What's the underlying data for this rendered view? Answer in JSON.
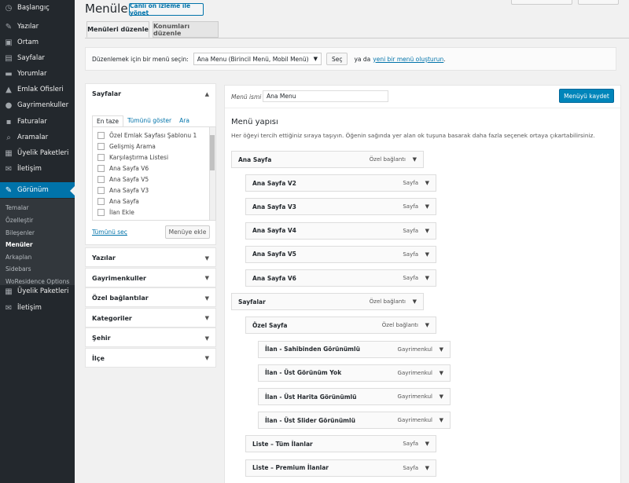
{
  "sidebar": {
    "items": [
      {
        "label": "Başlangıç",
        "icon": "dashboard-icon",
        "glyph": "◷"
      },
      {
        "label": "Yazılar",
        "icon": "pin-icon",
        "glyph": "✎"
      },
      {
        "label": "Ortam",
        "icon": "media-icon",
        "glyph": "▣"
      },
      {
        "label": "Sayfalar",
        "icon": "pages-icon",
        "glyph": "▤"
      },
      {
        "label": "Yorumlar",
        "icon": "comments-icon",
        "glyph": "▬"
      },
      {
        "label": "Emlak Ofisleri",
        "icon": "agency-icon",
        "glyph": "▲"
      },
      {
        "label": "Gayrimenkuller",
        "icon": "location-icon",
        "glyph": "●"
      },
      {
        "label": "Faturalar",
        "icon": "invoice-icon",
        "glyph": "▪"
      },
      {
        "label": "Aramalar",
        "icon": "search-icon",
        "glyph": "⌕"
      },
      {
        "label": "Üyelik Paketleri",
        "icon": "package-icon",
        "glyph": "▦"
      },
      {
        "label": "İletişim",
        "icon": "mail-icon",
        "glyph": "✉"
      },
      {
        "label": "Görünüm",
        "icon": "appearance-icon",
        "glyph": "✎"
      }
    ],
    "submenu": [
      "Temalar",
      "Özelleştir",
      "Bileşenler",
      "Menüler",
      "Arkaplan",
      "Sidebars",
      "WoResidence Options"
    ],
    "after": [
      {
        "label": "Üyelik Paketleri",
        "icon": "package-icon",
        "glyph": "▦"
      },
      {
        "label": "İletişim",
        "icon": "mail-icon",
        "glyph": "✉"
      }
    ]
  },
  "header": {
    "title": "Menüler",
    "live_button": "Canlı ön izleme ile yönet"
  },
  "tabs": [
    "Menüleri düzenle",
    "Konumları düzenle"
  ],
  "select_bar": {
    "label": "Düzenlemek için bir menü seçin:",
    "selected": "Ana Menu (Birincil Menü, Mobil Menü)",
    "button": "Seç",
    "or_text": "ya da",
    "new_link": "yeni bir menü oluşturun",
    "period": "."
  },
  "pages_box": {
    "title": "Sayfalar",
    "tabs": [
      "En taze",
      "Tümünü göster",
      "Ara"
    ],
    "items": [
      "Özel Emlak Sayfası Şablonu 1",
      "Gelişmiş Arama",
      "Karşılaştırma Listesi",
      "Ana Sayfa V6",
      "Ana Sayfa V5",
      "Ana Sayfa V3",
      "Ana Sayfa",
      "İlan Ekle"
    ],
    "select_all": "Tümünü seç",
    "add_button": "Menüye ekle"
  },
  "accordion": [
    "Yazılar",
    "Gayrimenkuller",
    "Özel bağlantılar",
    "Kategoriler",
    "Şehir",
    "İlçe"
  ],
  "editor": {
    "name_label": "Menü ismi",
    "name_value": "Ana Menu",
    "save_button": "Menüyü kaydet",
    "structure_title": "Menü yapısı",
    "structure_desc": "Her öğeyi tercih ettiğiniz sıraya taşıyın. Öğenin sağında yer alan ok tuşuna basarak daha fazla seçenek ortaya çıkartabilirsiniz."
  },
  "menu_items": [
    {
      "label": "Ana Sayfa",
      "type": "Özel bağlantı",
      "depth": 0
    },
    {
      "label": "Ana Sayfa V2",
      "type": "Sayfa",
      "depth": 1
    },
    {
      "label": "Ana Sayfa V3",
      "type": "Sayfa",
      "depth": 1
    },
    {
      "label": "Ana Sayfa V4",
      "type": "Sayfa",
      "depth": 1
    },
    {
      "label": "Ana Sayfa V5",
      "type": "Sayfa",
      "depth": 1
    },
    {
      "label": "Ana Sayfa V6",
      "type": "Sayfa",
      "depth": 1
    },
    {
      "label": "Sayfalar",
      "type": "Özel bağlantı",
      "depth": 0
    },
    {
      "label": "Özel Sayfa",
      "type": "Özel bağlantı",
      "depth": 1
    },
    {
      "label": "İlan - Sahibinden Görünümlü",
      "type": "Gayrimenkul",
      "depth": 2
    },
    {
      "label": "İlan - Üst Görünüm Yok",
      "type": "Gayrimenkul",
      "depth": 2
    },
    {
      "label": "İlan - Üst Harita Görünümlü",
      "type": "Gayrimenkul",
      "depth": 2
    },
    {
      "label": "İlan - Üst Slider Görünümlü",
      "type": "Gayrimenkul",
      "depth": 2
    },
    {
      "label": "Liste – Tüm İlanlar",
      "type": "Sayfa",
      "depth": 1
    },
    {
      "label": "Liste – Premium İlanlar",
      "type": "Sayfa",
      "depth": 1
    }
  ]
}
